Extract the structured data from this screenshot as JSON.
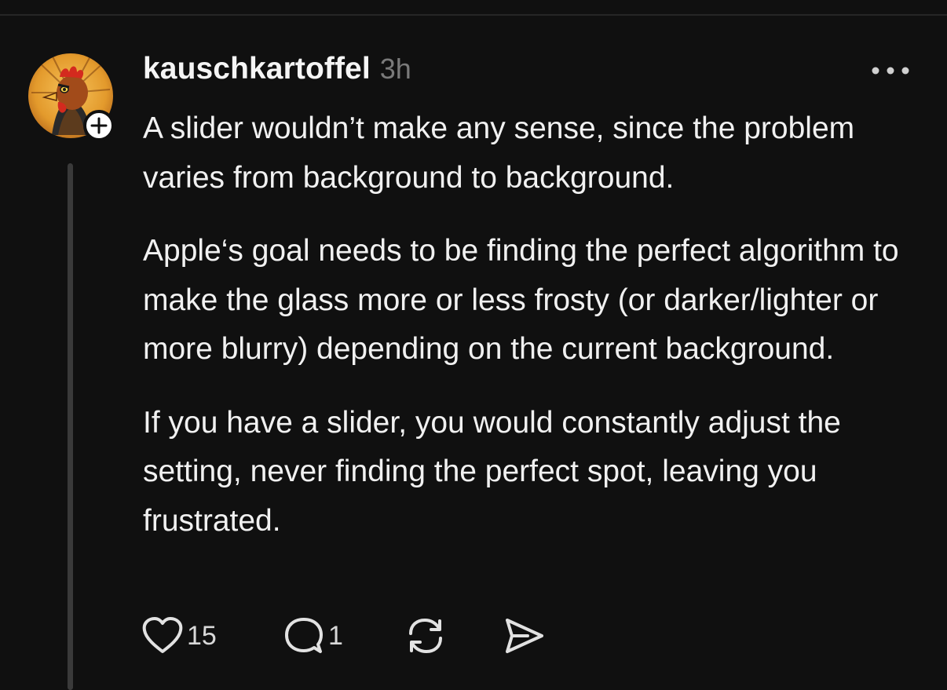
{
  "post": {
    "username": "kauschkartoffel",
    "time": "3h",
    "paragraphs": [
      "A slider wouldn’t make any sense, since the problem varies from background to background.",
      "Apple‘s goal needs to be finding the perfect algorithm to make the glass more or less frosty (or darker/lighter or more blurry) depending on the current background.",
      "If you have a slider, you would constantly adjust the setting, never finding the perfect spot, leaving you frustrated."
    ],
    "avatar_icon": "rooster-avatar",
    "follow_icon": "plus-icon",
    "more_icon": "more-dots-icon"
  },
  "actions": {
    "like": {
      "icon": "heart-icon",
      "count": "15"
    },
    "reply": {
      "icon": "comment-bubble-icon",
      "count": "1"
    },
    "repost": {
      "icon": "repost-icon"
    },
    "share": {
      "icon": "send-icon"
    }
  },
  "colors": {
    "background": "#101010",
    "text": "#f1f1f1",
    "muted": "#7a7a7a",
    "thread_line": "#3a3a3a"
  }
}
